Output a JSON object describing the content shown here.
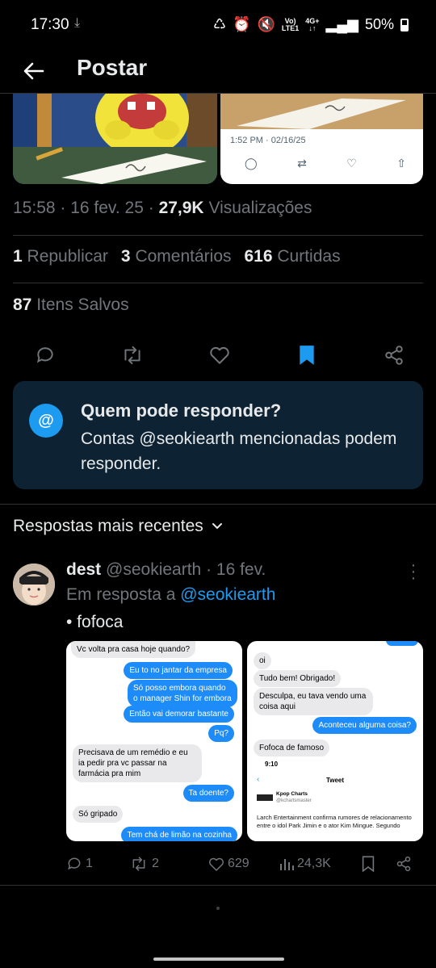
{
  "status_bar": {
    "time": "17:30",
    "network_top": "Vo)",
    "network_bottom": "LTE1",
    "data_top": "4G+",
    "battery": "50%"
  },
  "header": {
    "title": "Postar"
  },
  "media": {
    "timestamp": "1:52 PM · 02/16/25"
  },
  "post_meta": {
    "time": "15:58 · 16 fev. 25 · ",
    "views_count": "27,9K",
    "views_label": " Visualizações"
  },
  "stats": {
    "reposts_count": "1",
    "reposts_label": " Republicar",
    "comments_count": "3",
    "comments_label": " Comentários",
    "likes_count": "616",
    "likes_label": " Curtidas"
  },
  "saved": {
    "count": "87",
    "label": " Itens Salvos"
  },
  "reply_restriction": {
    "title": "Quem pode responder?",
    "description": "Contas @seokiearth mencionadas podem responder."
  },
  "sort": {
    "label": "Respostas mais recentes"
  },
  "reply": {
    "name": "dest",
    "handle_date": " @seokiearth · 16 fev.",
    "in_reply_prefix": "Em resposta a ",
    "in_reply_handle": "@seokiearth",
    "text": "• fofoca",
    "replies": "1",
    "reposts": "2",
    "likes": "629",
    "views": "24,3K"
  },
  "chat_left": {
    "m1": "Vc volta pra casa hoje quando?",
    "m2": "Eu to no jantar da empresa",
    "m3": "Só posso embora quando o manager Shin for embora",
    "m4": "Então vai demorar bastante",
    "m5": "Pq?",
    "m6": "Precisava de um remédio e eu ia pedir pra vc passar na farmácia pra mim",
    "m7": "Ta doente?",
    "m8": "Só gripado",
    "m9": "Tem chá de limão na cozinha"
  },
  "chat_right": {
    "m1": "oi",
    "m2": "Tudo bem! Obrigado!",
    "m3": "Desculpa, eu tava vendo uma coisa aqui",
    "m4": "Aconteceu alguma coisa?",
    "m5": "Fofoca de famoso",
    "embed_time": "9:10",
    "embed_title": "Tweet",
    "embed_account": "Kpop Charts",
    "embed_handle": "@kchartsmaster",
    "embed_text": "Larch Entertainment confirma rumores de relacionamento entre o idol Park Jimin e o ator Kim Mingue. Segundo"
  },
  "colors": {
    "accent": "#1d9bf0",
    "background": "#000000",
    "card": "#0d2233"
  }
}
